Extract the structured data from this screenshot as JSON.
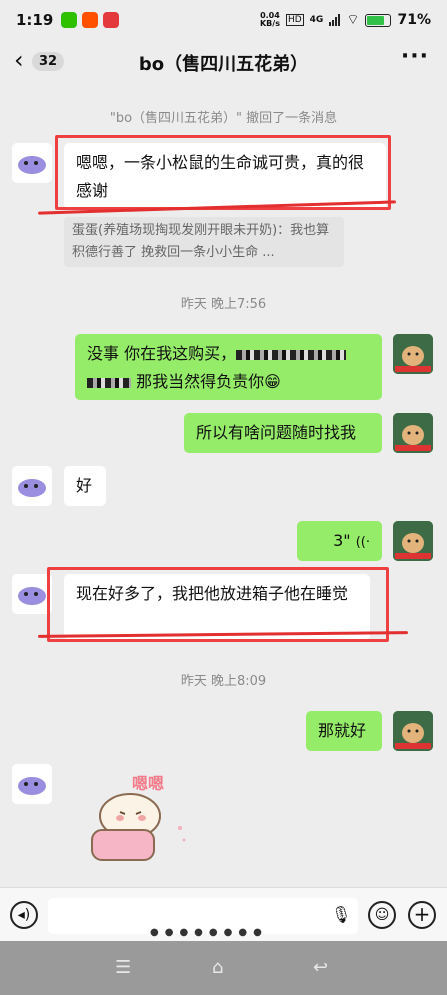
{
  "status": {
    "time": "1:19",
    "net_speed": "0.04",
    "net_unit": "KB/s",
    "net_type": "4G",
    "battery": "71%"
  },
  "header": {
    "back_icon": "chevron-left-icon",
    "unread": "32",
    "title": "bo（售四川五花弟）",
    "more": "···"
  },
  "messages": {
    "recall_notice": "\"bo（售四川五花弟）\" 撤回了一条消息",
    "m1": "嗯嗯，一条小松鼠的生命诚可贵，真的很感谢",
    "m1_quote": "蛋蛋(养殖场现掏现发刚开眼未开奶)：我也算积德行善了 挽救回一条小小生命 ...",
    "time1": "昨天 晚上7:56",
    "m2_prefix": "没事  你在我这购买，",
    "m2_suffix": "那我当然得负责你😁",
    "m3": "所以有啥问题随时找我",
    "m4": "好",
    "m5_voice": "3\"",
    "m6": "现在好多了，我把他放进箱子他在睡觉",
    "time2": "昨天 晚上8:09",
    "m7": "那就好",
    "sticker_text": "嗯嗯"
  },
  "colors": {
    "bubble_green": "#95ec69",
    "highlight_red": "#ee4040"
  }
}
